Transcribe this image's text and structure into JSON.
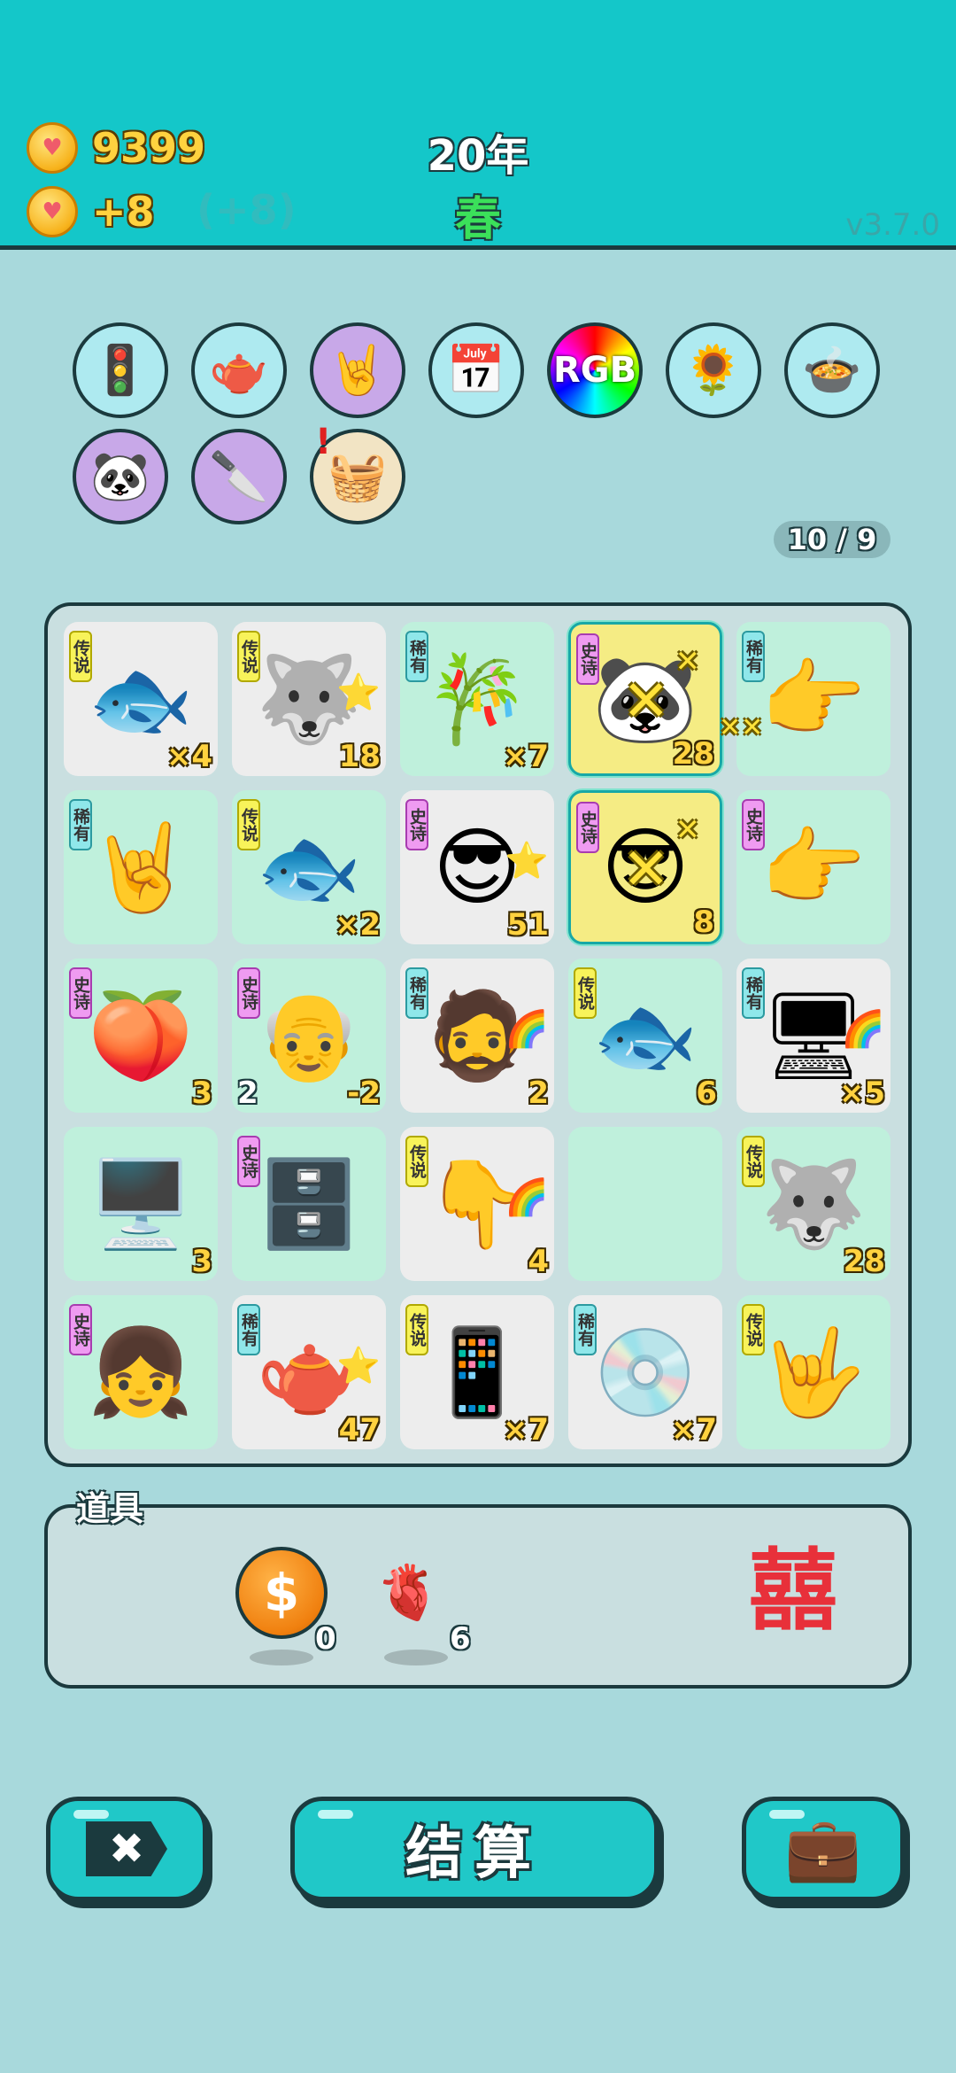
{
  "header": {
    "coins": "9399",
    "income": "+8",
    "income_ghost": "(+8)",
    "year": "20年",
    "season": "春",
    "version": "v3.7.0"
  },
  "relics": [
    {
      "icon": "traffic-light-ghost-icon",
      "glyph": "🚦"
    },
    {
      "icon": "gravy-boat-icon",
      "glyph": "🫖"
    },
    {
      "icon": "rock-hand-icon",
      "glyph": "🤘"
    },
    {
      "icon": "calendar-icon",
      "glyph": "📅"
    },
    {
      "icon": "rgb-icon",
      "text": "RGB"
    },
    {
      "icon": "sunflower-pair-icon",
      "glyph": "🌻"
    },
    {
      "icon": "duck-pot-icon",
      "glyph": "🍲"
    },
    {
      "icon": "panda-icon",
      "glyph": "🐼"
    },
    {
      "icon": "cleaver-icon",
      "glyph": "🔪"
    },
    {
      "icon": "fruit-basket-icon",
      "glyph": "🧺"
    }
  ],
  "spins": "10 / 9",
  "rarity": {
    "legend": "传说",
    "rare": "稀有",
    "epic": "史诗"
  },
  "board": [
    [
      {
        "icon": "koi-fish-icon",
        "glyph": "🐟",
        "rarity": "legend",
        "value": "×4",
        "bg": "white"
      },
      {
        "icon": "husky-king-icon",
        "glyph": "🐺",
        "rarity": "legend",
        "value": "18",
        "bg": "white",
        "badge": "⭐"
      },
      {
        "icon": "bamboo-icon",
        "glyph": "🎋",
        "rarity": "rare",
        "value": "×7",
        "bg": "mint"
      },
      {
        "icon": "panda-icon",
        "glyph": "🐼",
        "rarity": "epic",
        "value": "28",
        "bg": "hl",
        "crossed": true
      },
      {
        "icon": "pointing-hand-brown-icon",
        "glyph": "👉",
        "rarity": "rare",
        "value": "",
        "bg": "mint"
      }
    ],
    [
      {
        "icon": "rock-hand-brown-icon",
        "glyph": "🤘",
        "rarity": "rare",
        "value": "",
        "bg": "mint"
      },
      {
        "icon": "koi-fish-icon",
        "glyph": "🐟",
        "rarity": "legend",
        "value": "×2",
        "bg": "mint"
      },
      {
        "icon": "sunglasses-man-icon",
        "glyph": "😎",
        "rarity": "epic",
        "value": "51",
        "bg": "white",
        "badge": "⭐"
      },
      {
        "icon": "sunglasses-man-big-icon",
        "glyph": "😎",
        "rarity": "epic",
        "value": "8",
        "bg": "hl",
        "crossed": true
      },
      {
        "icon": "pointing-hand-gray-icon",
        "glyph": "👉",
        "rarity": "epic",
        "value": "",
        "bg": "mint"
      }
    ],
    [
      {
        "icon": "peach-icon",
        "glyph": "🍑",
        "rarity": "epic",
        "value": "3",
        "bg": "mint"
      },
      {
        "icon": "grandpa-icon",
        "glyph": "👴",
        "rarity": "epic",
        "value": "-2",
        "left": "2",
        "bg": "mint"
      },
      {
        "icon": "bucket-hat-man-icon",
        "glyph": "🧔",
        "rarity": "rare",
        "value": "2",
        "bg": "white",
        "badge": "🌈"
      },
      {
        "icon": "koi-fish-icon",
        "glyph": "🐟",
        "rarity": "legend",
        "value": "6",
        "bg": "mint"
      },
      {
        "icon": "server-tower-icon",
        "glyph": "🖥",
        "rarity": "rare",
        "value": "×5",
        "bg": "white",
        "badge": "🌈"
      }
    ],
    [
      {
        "icon": "monitor-icon",
        "glyph": "🖥️",
        "rarity": "",
        "value": "3",
        "bg": "mint"
      },
      {
        "icon": "server-rack-icon",
        "glyph": "🗄️",
        "rarity": "epic",
        "value": "",
        "bg": "mint"
      },
      {
        "icon": "pointing-hand-yellow-icon",
        "glyph": "👇",
        "rarity": "legend",
        "value": "4",
        "bg": "white",
        "badge": "🌈"
      },
      {
        "icon": "empty-slot",
        "glyph": "",
        "rarity": "",
        "value": "",
        "bg": "mint"
      },
      {
        "icon": "husky-king-icon",
        "glyph": "🐺",
        "rarity": "legend",
        "value": "28",
        "bg": "mint"
      }
    ],
    [
      {
        "icon": "girl-icon",
        "glyph": "👧",
        "rarity": "epic",
        "value": "",
        "bg": "mint"
      },
      {
        "icon": "teapot-icon",
        "glyph": "🫖",
        "rarity": "rare",
        "value": "47",
        "bg": "white",
        "badge": "⭐"
      },
      {
        "icon": "smartphone-icon",
        "glyph": "📱",
        "rarity": "legend",
        "value": "×7",
        "bg": "white"
      },
      {
        "icon": "cd-disc-icon",
        "glyph": "💿",
        "rarity": "rare",
        "value": "×7",
        "bg": "white"
      },
      {
        "icon": "yellow-hand-icon",
        "glyph": "🤟",
        "rarity": "legend",
        "value": "",
        "bg": "mint"
      }
    ]
  ],
  "tools": {
    "label": "道具",
    "coin_count": "0",
    "liver_count": "6",
    "coin_glyph": "$",
    "liver_glyph": "🫀",
    "double_happiness": "囍"
  },
  "buttons": {
    "close": "✖",
    "settle": "结算",
    "bag": "💼"
  },
  "colors": {
    "header": "#14c7c9",
    "background": "#a8d9dc",
    "gold": "#ffd23f",
    "button": "#20c8c8"
  }
}
